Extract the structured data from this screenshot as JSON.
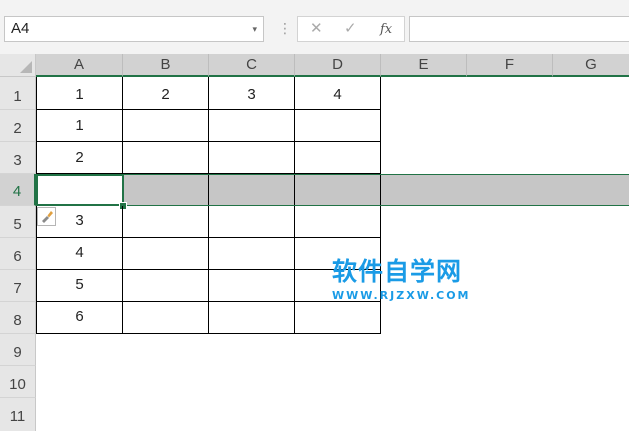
{
  "formula_bar": {
    "name_box": "A4",
    "name_box_arrow": "▾",
    "separator": "⋮",
    "cancel_icon": "✕",
    "enter_icon": "✓",
    "function_label": "fx",
    "formula_value": ""
  },
  "columns": [
    "A",
    "B",
    "C",
    "D",
    "E",
    "F",
    "G"
  ],
  "rows": [
    "1",
    "2",
    "3",
    "4",
    "5",
    "6",
    "7",
    "8",
    "9",
    "10",
    "11"
  ],
  "cells": {
    "A1": "1",
    "B1": "2",
    "C1": "3",
    "D1": "4",
    "A2": "1",
    "A3": "2",
    "A5": "3",
    "A6": "4",
    "A7": "5",
    "A8": "6"
  },
  "selection": {
    "active_cell": "A4",
    "selected_row": "4"
  },
  "paste_options_icon": "paintbrush-icon",
  "watermark": {
    "title": "软件自学网",
    "url": "WWW.RJZXW.COM"
  },
  "colors": {
    "accent_green": "#217346",
    "row_highlight_gray": "#c6c6c6",
    "watermark_blue": "#1a9be6"
  }
}
